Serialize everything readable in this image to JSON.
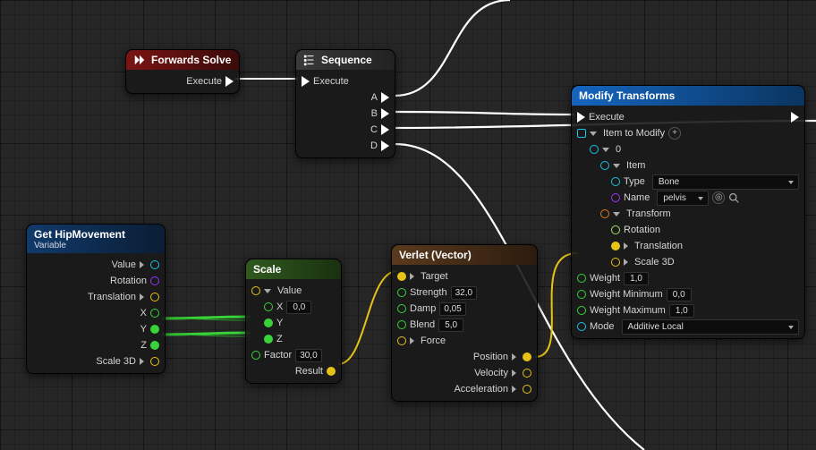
{
  "nodes": {
    "forwards": {
      "title": "Forwards Solve",
      "pin_execute": "Execute"
    },
    "sequence": {
      "title": "Sequence",
      "pin_execute": "Execute",
      "outs": [
        "A",
        "B",
        "C",
        "D"
      ]
    },
    "gethip": {
      "title": "Get HipMovement",
      "subtitle": "Variable",
      "outs": {
        "value": "Value",
        "rotation": "Rotation",
        "translation": "Translation",
        "x": "X",
        "y": "Y",
        "z": "Z",
        "scale3d": "Scale 3D"
      }
    },
    "scale": {
      "title": "Scale",
      "in_value": "Value",
      "x": "X",
      "x_val": "0,0",
      "y": "Y",
      "z": "Z",
      "factor": "Factor",
      "factor_val": "30,0",
      "out_result": "Result"
    },
    "verlet": {
      "title": "Verlet (Vector)",
      "ins": {
        "target": "Target",
        "strength": "Strength",
        "damp": "Damp",
        "blend": "Blend",
        "force": "Force"
      },
      "vals": {
        "strength": "32,0",
        "damp": "0,05",
        "blend": "5,0"
      },
      "outs": {
        "position": "Position",
        "velocity": "Velocity",
        "acceleration": "Acceleration"
      }
    },
    "modify": {
      "title": "Modify Transforms",
      "pin_execute": "Execute",
      "item_to_modify": "Item to Modify",
      "idx0": "0",
      "item": "Item",
      "type_label": "Type",
      "type_val": "Bone",
      "name_label": "Name",
      "name_val": "pelvis",
      "transform": "Transform",
      "rotation": "Rotation",
      "translation": "Translation",
      "scale3d": "Scale 3D",
      "weight": "Weight",
      "weight_val": "1,0",
      "wmin": "Weight Minimum",
      "wmin_val": "0,0",
      "wmax": "Weight Maximum",
      "wmax_val": "1,0",
      "mode": "Mode",
      "mode_val": "Additive Local"
    }
  },
  "chart_data": {
    "type": "node_graph",
    "tool": "Unreal Engine Blueprint / Control Rig Graph",
    "nodes": [
      {
        "id": "forwards",
        "title": "Forwards Solve",
        "kind": "event",
        "pins_out": [
          "Execute"
        ]
      },
      {
        "id": "sequence",
        "title": "Sequence",
        "pins_in": [
          "Execute"
        ],
        "pins_out": [
          "A",
          "B",
          "C",
          "D"
        ]
      },
      {
        "id": "gethip",
        "title": "Get HipMovement",
        "kind": "variable-get",
        "pins_out": [
          "Value",
          "Rotation",
          "Translation",
          "X",
          "Y",
          "Z",
          "Scale 3D"
        ]
      },
      {
        "id": "scale",
        "title": "Scale",
        "pins_in": [
          "Value",
          "X",
          "Y",
          "Z",
          "Factor"
        ],
        "defaults": {
          "X": "0,0",
          "Factor": "30,0"
        },
        "pins_out": [
          "Result"
        ]
      },
      {
        "id": "verlet",
        "title": "Verlet (Vector)",
        "pins_in": [
          "Target",
          "Strength",
          "Damp",
          "Blend",
          "Force"
        ],
        "defaults": {
          "Strength": "32,0",
          "Damp": "0,05",
          "Blend": "5,0"
        },
        "pins_out": [
          "Position",
          "Velocity",
          "Acceleration"
        ]
      },
      {
        "id": "modify",
        "title": "Modify Transforms",
        "pins_in": [
          "Execute",
          "Item to Modify",
          "0",
          "Item",
          "Type",
          "Name",
          "Transform",
          "Rotation",
          "Translation",
          "Scale 3D",
          "Weight",
          "Weight Minimum",
          "Weight Maximum",
          "Mode"
        ],
        "defaults": {
          "Type": "Bone",
          "Name": "pelvis",
          "Weight": "1,0",
          "Weight Minimum": "0,0",
          "Weight Maximum": "1,0",
          "Mode": "Additive Local"
        },
        "pins_out": [
          "Execute"
        ]
      }
    ],
    "edges": [
      {
        "from": "forwards.Execute",
        "to": "sequence.Execute",
        "type": "exec"
      },
      {
        "from": "sequence.A",
        "to": "offscreen_top",
        "type": "exec"
      },
      {
        "from": "sequence.B",
        "to": "modify.Execute",
        "type": "exec"
      },
      {
        "from": "sequence.C",
        "to": "offscreen_right",
        "type": "exec"
      },
      {
        "from": "sequence.D",
        "to": "offscreen_bottom",
        "type": "exec"
      },
      {
        "from": "gethip.Y",
        "to": "scale.Y",
        "type": "float"
      },
      {
        "from": "gethip.Z",
        "to": "scale.Z",
        "type": "float"
      },
      {
        "from": "scale.Result",
        "to": "verlet.Target",
        "type": "vector"
      },
      {
        "from": "verlet.Position",
        "to": "modify.Translation",
        "type": "vector"
      }
    ]
  }
}
